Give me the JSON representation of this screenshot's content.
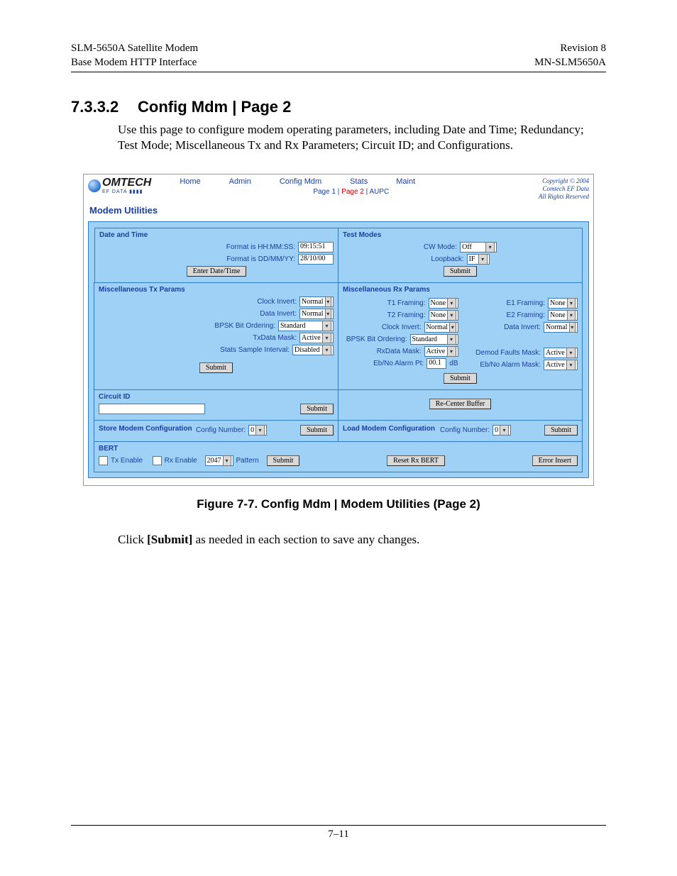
{
  "header": {
    "left1": "SLM-5650A Satellite Modem",
    "left2": "Base Modem HTTP Interface",
    "right1": "Revision 8",
    "right2": "MN-SLM5650A"
  },
  "section": {
    "number": "7.3.3.2",
    "title": "Config Mdm | Page 2",
    "intro": "Use this page to configure modem operating parameters, including Date and Time; Redundancy; Test Mode; Miscellaneous Tx and Rx Parameters; Circuit ID; and Configurations."
  },
  "ui": {
    "logo": "OMTECH",
    "logo_sub": "EF DATA ▮▮▮▮",
    "nav": {
      "home": "Home",
      "admin": "Admin",
      "config": "Config Mdm",
      "stats": "Stats",
      "maint": "Maint"
    },
    "subnav": {
      "p1": "Page 1",
      "p2": "Page 2",
      "aupc": "AUPC"
    },
    "copy": {
      "l1": "Copyright © 2004",
      "l2": "Comtech EF Data",
      "l3": "All Rights Reserved"
    },
    "main_title": "Modem Utilities",
    "submit": "Submit",
    "recenter": "Re-Center Buffer",
    "dt": {
      "title": "Date and Time",
      "time_lab": "Format is HH:MM:SS:",
      "time_val": "09:15:51",
      "date_lab": "Format is DD/MM/YY:",
      "date_val": "28/10/00",
      "btn": "Enter Date/Time"
    },
    "tm": {
      "title": "Test Modes",
      "cw_lab": "CW Mode:",
      "cw_val": "Off",
      "lb_lab": "Loopback:",
      "lb_val": "IF"
    },
    "tx": {
      "title": "Miscellaneous Tx Params",
      "ci_lab": "Clock Invert:",
      "ci_val": "Normal",
      "di_lab": "Data Invert:",
      "di_val": "Normal",
      "bo_lab": "BPSK Bit Ordering:",
      "bo_val": "Standard",
      "dm_lab": "TxData Mask:",
      "dm_val": "Active",
      "si_lab": "Stats Sample Interval:",
      "si_val": "Disabled"
    },
    "rx": {
      "title": "Miscellaneous Rx Params",
      "t1_lab": "T1 Framing:",
      "t2_lab": "T2 Framing:",
      "e1_lab": "E1 Framing:",
      "e2_lab": "E2 Framing:",
      "ci_lab": "Clock Invert:",
      "di_lab": "Data Invert:",
      "bo_lab": "BPSK Bit Ordering:",
      "dm_lab": "RxData Mask:",
      "df_lab": "Demod Faults Mask:",
      "am_lab": "Eb/No Alarm Mask:",
      "eb_lab": "Eb/No Alarm Pt:",
      "eb_val": "00.1",
      "eb_unit": "dB",
      "none": "None",
      "normal": "Normal",
      "std": "Standard",
      "active": "Active"
    },
    "cid": {
      "title": "Circuit ID"
    },
    "store": {
      "title": "Store Modem Configuration",
      "lab": "Config Number:",
      "val": "0"
    },
    "load": {
      "title": "Load Modem Configuration",
      "lab": "Config Number:",
      "val": "0"
    },
    "bert": {
      "title": "BERT",
      "tx": "Tx Enable",
      "rx": "Rx Enable",
      "pat_val": "2047",
      "pat_lab": "Pattern",
      "reset": "Reset Rx BERT",
      "err": "Error Insert"
    }
  },
  "figure": {
    "caption": "Figure 7-7. Config Mdm | Modem Utilities (Page 2)"
  },
  "after": {
    "pre": "Click",
    "bold": "[Submit]",
    "post": "as needed in each section to save any changes."
  },
  "footer": {
    "page": "7–11"
  }
}
